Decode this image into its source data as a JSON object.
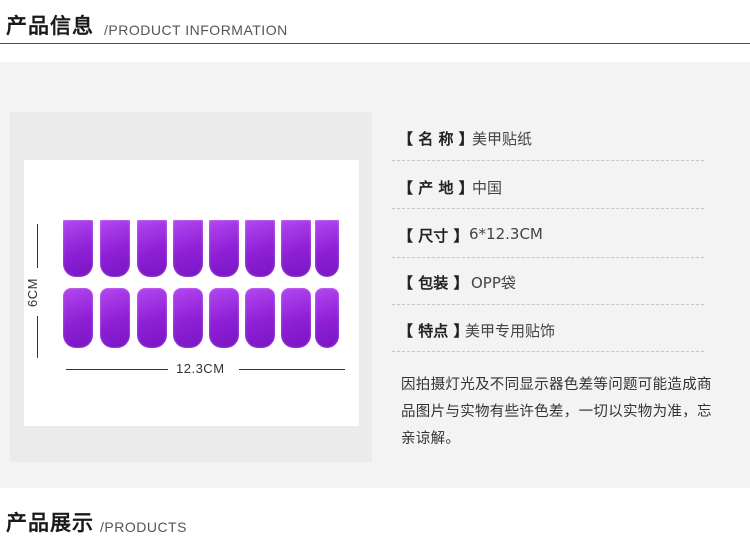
{
  "header_top": {
    "title_cn": "产品信息",
    "title_en": "/PRODUCT INFORMATION"
  },
  "header_bottom": {
    "title_cn": "产品展示",
    "title_en": "/PRODUCTS"
  },
  "photo": {
    "width_label": "12.3CM",
    "height_label": "6CM",
    "nail_color": "#9a2be0"
  },
  "specs": [
    {
      "label": "【 名 称 】",
      "value": "美甲贴纸"
    },
    {
      "label": "【 产 地 】",
      "value": "中国"
    },
    {
      "label": "【 尺寸 】",
      "value": "6*12.3CM"
    },
    {
      "label": "【 包装 】",
      "value": "OPP袋"
    },
    {
      "label": "【 特点 】",
      "value": "美甲专用贴饰"
    }
  ],
  "note": "因拍摄灯光及不同显示器色差等问题可能造成商品图片与实物有些许色差，一切以实物为准，忘亲谅解。"
}
